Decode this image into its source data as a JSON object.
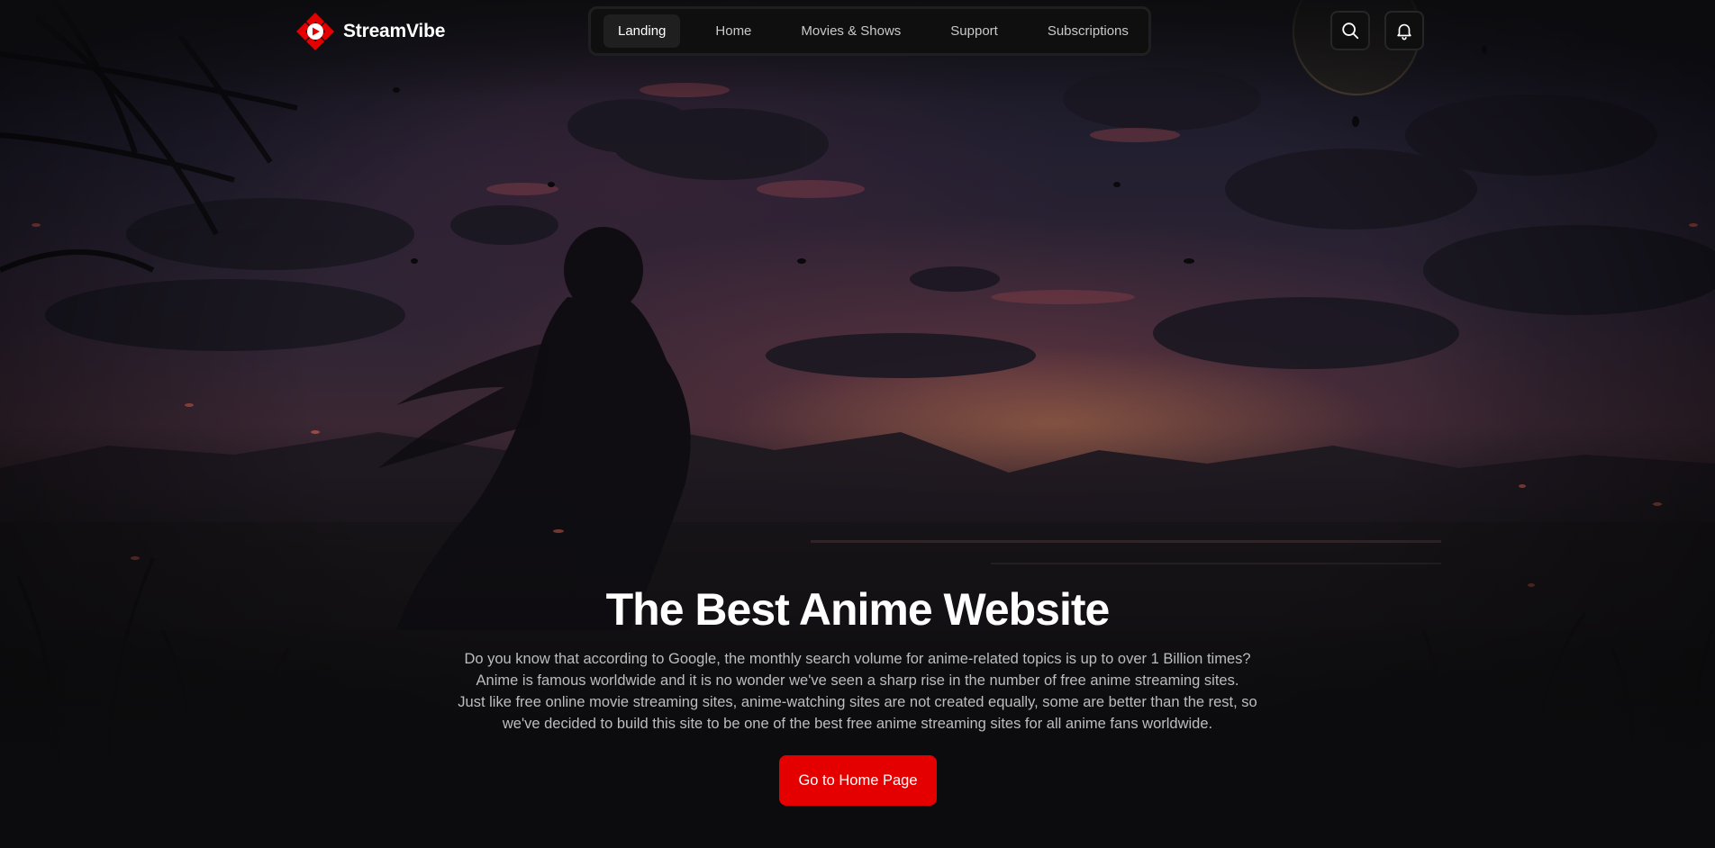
{
  "brand": {
    "name": "StreamVibe",
    "accent_color": "#e50000"
  },
  "nav": {
    "items": [
      {
        "label": "Landing",
        "active": true
      },
      {
        "label": "Home",
        "active": false
      },
      {
        "label": "Movies & Shows",
        "active": false
      },
      {
        "label": "Support",
        "active": false
      },
      {
        "label": "Subscriptions",
        "active": false
      }
    ]
  },
  "actions": {
    "search_icon": "search-icon",
    "notification_icon": "bell-icon"
  },
  "hero": {
    "title": "The Best Anime Website",
    "description": [
      "Do you know that according to Google, the monthly search volume for anime-related topics is up to over 1 Billion times?",
      "Anime is famous worldwide and it is no wonder we've seen a sharp rise in the number of free anime streaming sites.",
      "Just like free online movie streaming sites, anime-watching sites are not created equally, some are better than the rest, so",
      "we've decided to build this site to be one of the best free anime streaming sites for all anime fans worldwide."
    ],
    "cta_label": "Go to Home Page"
  }
}
